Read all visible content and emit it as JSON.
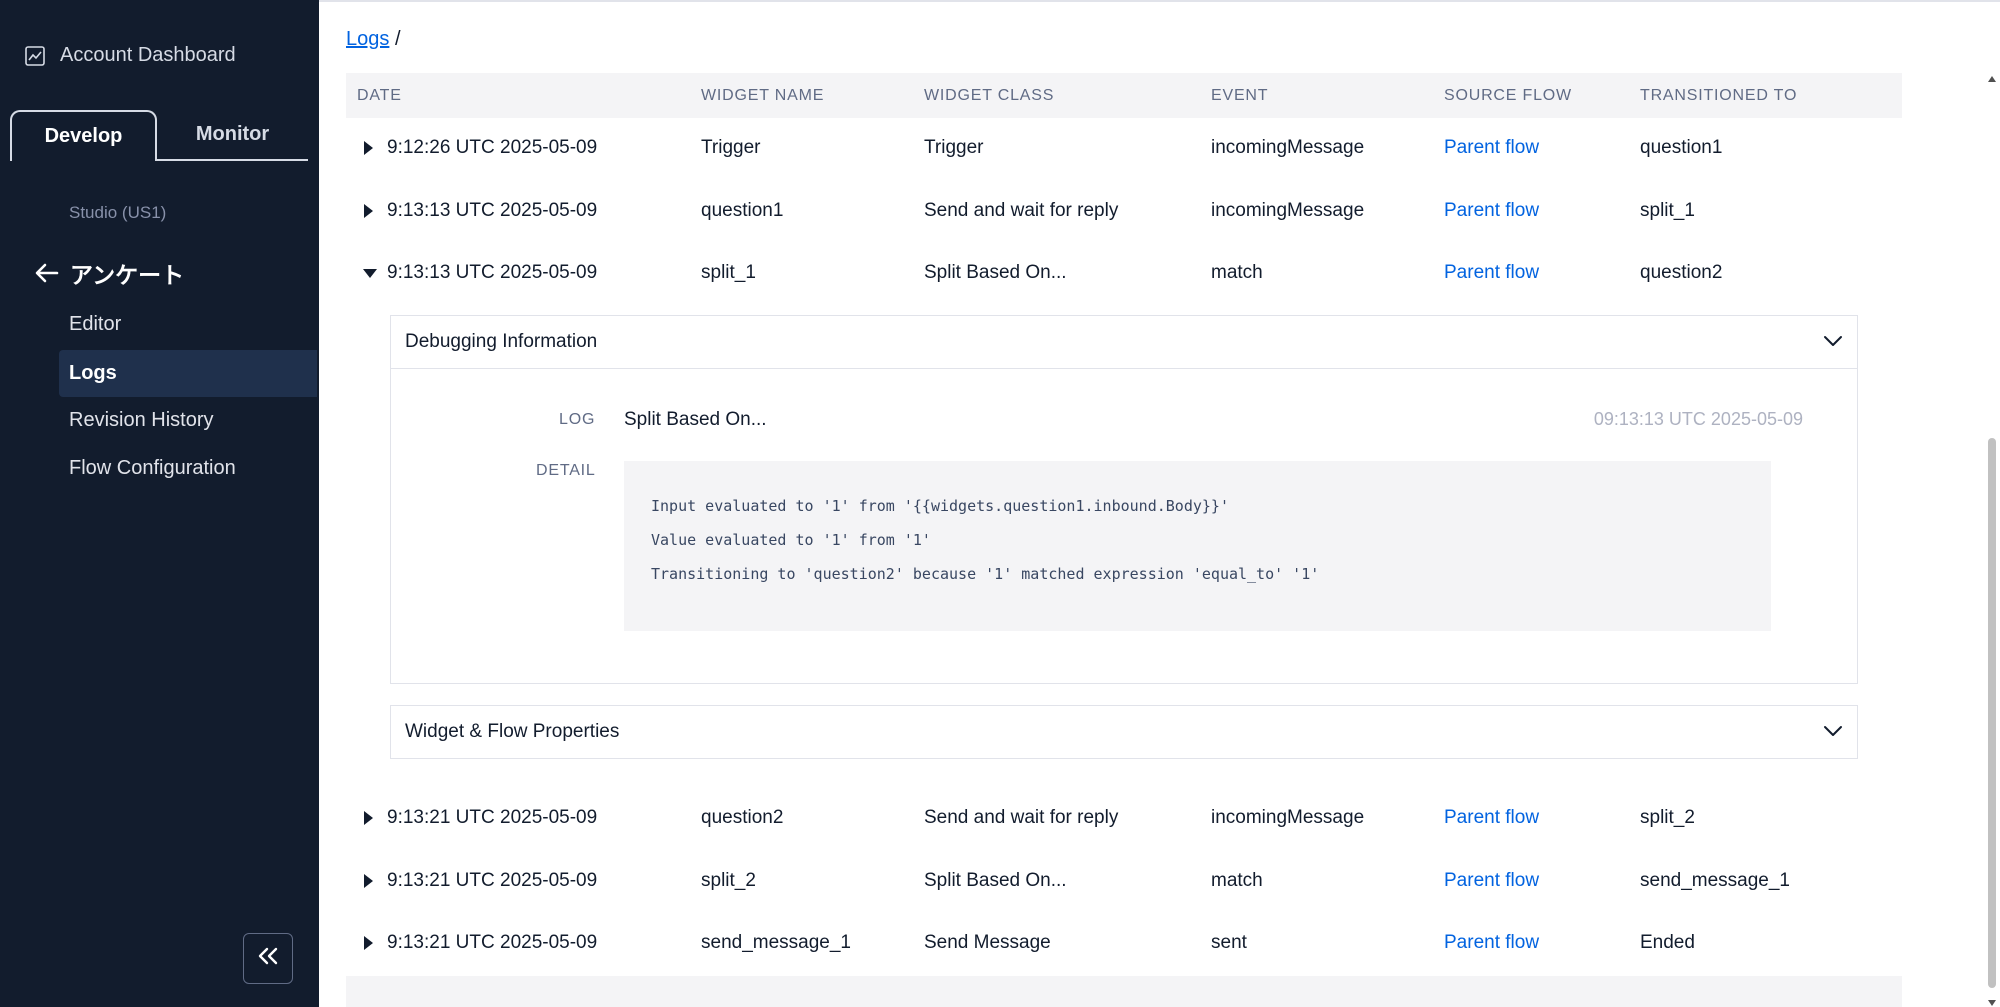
{
  "sidebar": {
    "account_dashboard": "Account Dashboard",
    "tabs": {
      "develop": "Develop",
      "monitor": "Monitor"
    },
    "studio": "Studio (US1)",
    "flow_name": "アンケート",
    "nav": [
      {
        "label": "Editor"
      },
      {
        "label": "Logs"
      },
      {
        "label": "Revision History"
      },
      {
        "label": "Flow Configuration"
      }
    ],
    "active_nav": "Logs"
  },
  "breadcrumb": {
    "link": "Logs",
    "separator": "/"
  },
  "table": {
    "headers": {
      "date": "DATE",
      "widget_name": "WIDGET NAME",
      "widget_class": "WIDGET CLASS",
      "event": "EVENT",
      "source_flow": "SOURCE FLOW",
      "transitioned_to": "TRANSITIONED TO"
    },
    "rows": [
      {
        "date": "9:12:26 UTC 2025-05-09",
        "widget_name": "Trigger",
        "widget_class": "Trigger",
        "event": "incomingMessage",
        "source_flow": "Parent flow",
        "transitioned_to": "question1"
      },
      {
        "date": "9:13:13 UTC 2025-05-09",
        "widget_name": "question1",
        "widget_class": "Send and wait for reply",
        "event": "incomingMessage",
        "source_flow": "Parent flow",
        "transitioned_to": "split_1"
      },
      {
        "date": "9:13:13 UTC 2025-05-09",
        "widget_name": "split_1",
        "widget_class": "Split Based On...",
        "event": "match",
        "source_flow": "Parent flow",
        "transitioned_to": "question2"
      },
      {
        "date": "9:13:21 UTC 2025-05-09",
        "widget_name": "question2",
        "widget_class": "Send and wait for reply",
        "event": "incomingMessage",
        "source_flow": "Parent flow",
        "transitioned_to": "split_2"
      },
      {
        "date": "9:13:21 UTC 2025-05-09",
        "widget_name": "split_2",
        "widget_class": "Split Based On...",
        "event": "match",
        "source_flow": "Parent flow",
        "transitioned_to": "send_message_1"
      },
      {
        "date": "9:13:21 UTC 2025-05-09",
        "widget_name": "send_message_1",
        "widget_class": "Send Message",
        "event": "sent",
        "source_flow": "Parent flow",
        "transitioned_to": "Ended"
      }
    ]
  },
  "expanded": {
    "debugging_title": "Debugging Information",
    "log_label": "LOG",
    "log_value": "Split Based On...",
    "log_time": "09:13:13 UTC 2025-05-09",
    "detail_label": "DETAIL",
    "detail_lines": [
      "Input evaluated to '1' from '{{widgets.question1.inbound.Body}}'",
      "Value evaluated to '1' from '1'",
      "Transitioning to 'question2' because '1' matched expression 'equal_to' '1'"
    ],
    "properties_title": "Widget & Flow Properties"
  },
  "colors": {
    "sidebar_bg": "#121c2d",
    "sidebar_active": "#1f304c",
    "link": "#0263e0",
    "header_bg": "#f4f4f6"
  }
}
